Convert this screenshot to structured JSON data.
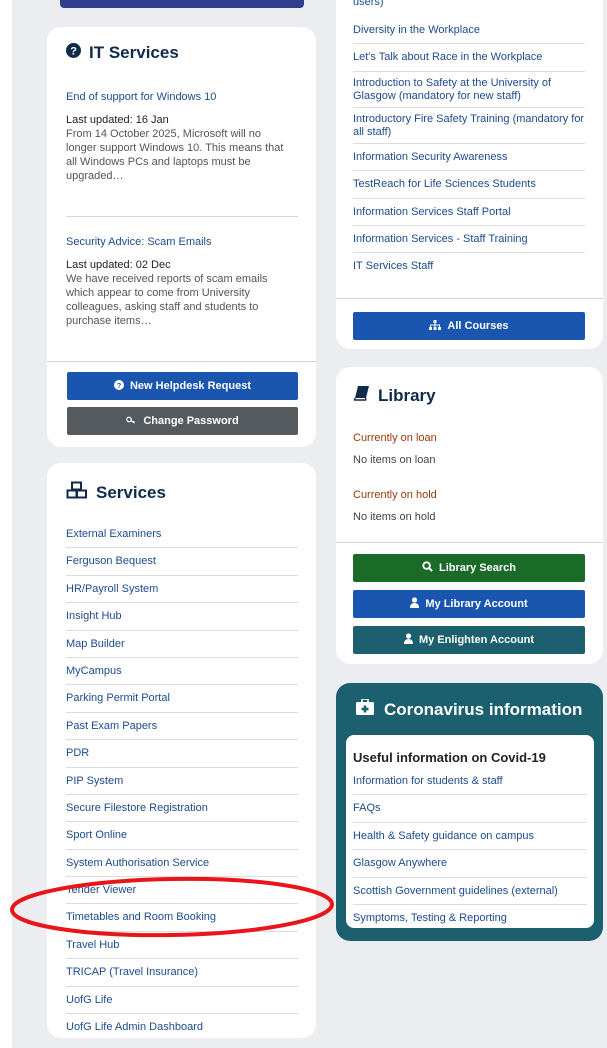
{
  "it_services": {
    "title": "IT Services",
    "news": [
      {
        "title": "End of support for Windows 10",
        "updated": "Last updated: 16 Jan",
        "body": "From 14 October 2025, Microsoft will no longer support Windows 10. This means that all Windows PCs and laptops must be upgraded…"
      },
      {
        "title": "Security Advice: Scam Emails",
        "updated": "Last updated: 02 Dec",
        "body": "We have received reports of scam emails which appear to come from University colleagues, asking staff and students to purchase items…"
      }
    ],
    "helpdesk_button": "New Helpdesk Request",
    "password_button": "Change Password"
  },
  "services": {
    "title": "Services",
    "items": [
      "External Examiners",
      "Ferguson Bequest",
      "HR/Payroll System",
      "Insight Hub",
      "Map Builder",
      "MyCampus",
      "Parking Permit Portal",
      "Past Exam Papers",
      "PDR",
      "PIP System",
      "Secure Filestore Registration",
      "Sport Online",
      "System Authorisation Service",
      "Tender Viewer",
      "Timetables and Room Booking",
      "Travel Hub",
      "TRICAP (Travel Insurance)",
      "UofG Life",
      "UofG Life Admin Dashboard"
    ]
  },
  "courses": {
    "top_fragment": "users)",
    "items": [
      "Diversity in the Workplace",
      "Let's Talk about Race in the Workplace",
      "Introduction to Safety at the University of Glasgow (mandatory for new staff)",
      "Introductory Fire Safety Training (mandatory for all staff)",
      "Information Security Awareness",
      "TestReach for Life Sciences Students",
      "Information Services Staff Portal",
      "Information Services - Staff Training",
      "IT Services Staff"
    ],
    "all_button": "All Courses"
  },
  "library": {
    "title": "Library",
    "loan_heading": "Currently on loan",
    "loan_text": "No items on loan",
    "hold_heading": "Currently on hold",
    "hold_text": "No items on hold",
    "search_button": "Library Search",
    "account_button": "My Library Account",
    "enlighten_button": "My Enlighten Account"
  },
  "covid": {
    "title": "Coronavirus information",
    "subtitle": "Useful information on Covid-19",
    "items": [
      "Information for students & staff",
      "FAQs",
      "Health & Safety guidance on campus",
      "Glasgow Anywhere",
      "Scottish Government guidelines (external)",
      "Symptoms, Testing & Reporting"
    ]
  },
  "colors": {
    "accent": "#1a56b0",
    "heading": "#0f2a4a",
    "library_heading": "#9a3a0a",
    "covid_bg": "#1c5f6e",
    "annotation": "#e8161b"
  }
}
